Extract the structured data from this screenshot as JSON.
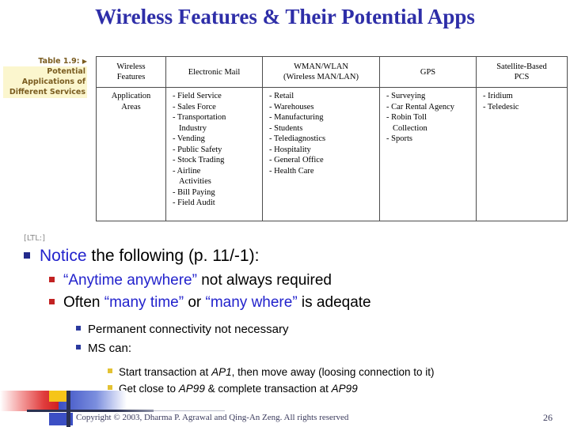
{
  "slide": {
    "title": "Wireless Features & Their Potential Apps",
    "page_number": "26",
    "copyright": "Copyright © 2003, Dharma P. Agrawal and Qing-An Zeng. All rights reserved",
    "title_color": "#2e2ea8"
  },
  "caption": {
    "line1": "Table 1.9:",
    "arrow": "▶",
    "line2": "Potential",
    "line3": "Applications of",
    "line4": "Different Services",
    "bg_color": "#fbf6ce",
    "text_color": "#7a5c20"
  },
  "table": {
    "headers": [
      "Wireless\nFeatures",
      "Electronic Mail",
      "WMAN/WLAN\n(Wireless MAN/LAN)",
      "GPS",
      "Satellite-Based\nPCS"
    ],
    "row_label": "Application\nAreas",
    "columns": [
      {
        "name": "Electronic Mail",
        "items": [
          "- Field Service",
          "- Sales Force",
          "- Transportation\n  Industry",
          "- Vending",
          "- Public Safety",
          "- Stock Trading",
          "- Airline\n  Activities",
          "- Bill Paying",
          "- Field Audit"
        ]
      },
      {
        "name": "WMAN/WLAN",
        "items": [
          "- Retail",
          "- Warehouses",
          "- Manufacturing",
          "- Students",
          "- Telediagnostics",
          "- Hospitality",
          "- General Office",
          "- Health Care"
        ]
      },
      {
        "name": "GPS",
        "items": [
          "- Surveying",
          "- Car Rental Agency",
          "- Robin Toll\n  Collection",
          "- Sports"
        ]
      },
      {
        "name": "Satellite-Based PCS",
        "items": [
          "- Iridium",
          "- Teledesic"
        ]
      }
    ]
  },
  "body": {
    "ltl_tag": "[LTL:]",
    "bullets": {
      "notice": {
        "highlight": "Notice",
        "rest": " the following (p. 11/-1):"
      },
      "anytime": {
        "quote": "“Anytime anywhere”",
        "rest": " not always required"
      },
      "often": {
        "prefix": "Often ",
        "quote1": "“many time”",
        "mid": " or ",
        "quote2": "“many where”",
        "suffix": " is adeqate"
      },
      "permanent": "Permanent connectivity not necessary",
      "ms_can": "MS can:",
      "start_transaction": {
        "pre": "Start transaction at ",
        "ap1": "AP1",
        "post": ", then move away (loosing connection to it)"
      },
      "get_close": {
        "pre": "Get close to ",
        "ap99a": "AP99",
        "mid": " & complete transaction at ",
        "ap99b": "AP99"
      }
    },
    "bullet_colors": {
      "level1": "#232a8c",
      "level2": "#c22222",
      "level3": "#2b3a9e",
      "level4": "#e3c233",
      "highlight_text": "#2222cc"
    }
  }
}
